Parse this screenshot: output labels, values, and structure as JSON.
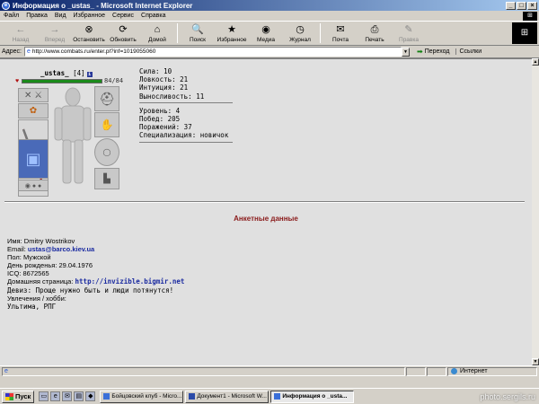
{
  "window": {
    "title": "Информация о _ustas_ - Microsoft Internet Explorer",
    "minimize_glyph": "_",
    "maximize_glyph": "□",
    "close_glyph": "×"
  },
  "menu": {
    "items": [
      "Файл",
      "Правка",
      "Вид",
      "Избранное",
      "Сервис",
      "Справка"
    ]
  },
  "toolbar": {
    "buttons": [
      {
        "label": "Назад",
        "icon": "back-arrow-icon",
        "glyph": "←",
        "disabled": true
      },
      {
        "label": "Вперед",
        "icon": "forward-arrow-icon",
        "glyph": "→",
        "disabled": true
      },
      {
        "label": "Остановить",
        "icon": "stop-icon",
        "glyph": "⊗",
        "disabled": false
      },
      {
        "label": "Обновить",
        "icon": "refresh-icon",
        "glyph": "⟳",
        "disabled": false
      },
      {
        "label": "Домой",
        "icon": "home-icon",
        "glyph": "⌂",
        "disabled": false
      },
      {
        "label": "Поиск",
        "icon": "search-icon",
        "glyph": "🔍",
        "disabled": false
      },
      {
        "label": "Избранное",
        "icon": "favorites-icon",
        "glyph": "★",
        "disabled": false
      },
      {
        "label": "Медиа",
        "icon": "media-icon",
        "glyph": "◉",
        "disabled": false
      },
      {
        "label": "Журнал",
        "icon": "history-icon",
        "glyph": "◷",
        "disabled": false
      },
      {
        "label": "Почта",
        "icon": "mail-icon",
        "glyph": "✉",
        "disabled": false
      },
      {
        "label": "Печать",
        "icon": "print-icon",
        "glyph": "⎙",
        "disabled": false
      },
      {
        "label": "Правка",
        "icon": "edit-icon",
        "glyph": "✎",
        "disabled": true
      }
    ]
  },
  "address": {
    "label": "Адрес:",
    "url": "http://www.combats.ru/enter.pl?inf=1019055060",
    "go_label": "Переход",
    "links_label": "Ссылки"
  },
  "character": {
    "name": "_ustas_",
    "level_text": "[4]",
    "info_glyph": "i",
    "hp_text": "84/84",
    "hp_fraction": 1.0,
    "stats": [
      "Сила: 10",
      "Ловкость: 21",
      "Интуиция: 21",
      "Выносливость: 11"
    ],
    "record": [
      "Уровень: 4",
      "Побед: 205",
      "Поражений: 37",
      "Специализация: новичок"
    ]
  },
  "profile": {
    "section_title": "Анкетные данные",
    "name_line": "Имя: Dmitry Wostrikov",
    "email_label": "Email: ",
    "email": "ustas@barco.kiev.ua",
    "gender": "Пол: Мужской",
    "birthday": "День рожденья: 29.04.1976",
    "icq": "ICQ: 8672565",
    "homepage_label": "Домашняя страница: ",
    "homepage": "http://invizible.bigmir.net",
    "motto": "Девиз: Проще нужно быть и люди потянутся!",
    "hobby_label": "Увлечения / хобби:",
    "hobby": "Ультима, РПГ"
  },
  "status": {
    "zone": "Интернет"
  },
  "taskbar": {
    "start_label": "Пуск",
    "tasks": [
      {
        "label": "Бойцовский клуб - Micro...",
        "active": false
      },
      {
        "label": "Документ1 - Microsoft W...",
        "active": false
      },
      {
        "label": "Информация о _usta...",
        "active": true
      }
    ]
  },
  "watermark": "photo.sergils.ru"
}
